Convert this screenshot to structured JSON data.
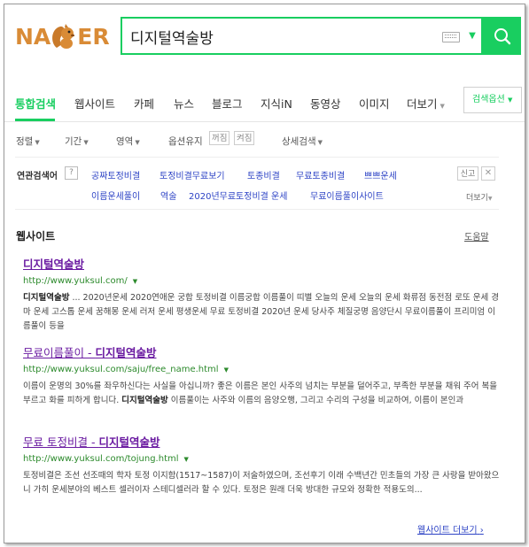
{
  "header": {
    "logo_left": "NA",
    "logo_right": "ER",
    "query": "디지털역술방"
  },
  "tabs": [
    {
      "label": "통합검색"
    },
    {
      "label": "웹사이트"
    },
    {
      "label": "카페"
    },
    {
      "label": "뉴스"
    },
    {
      "label": "블로그"
    },
    {
      "label": "지식iN"
    },
    {
      "label": "동영상"
    },
    {
      "label": "이미지"
    },
    {
      "label": "더보기"
    }
  ],
  "search_options_label": "검색옵션",
  "filters": {
    "sort": "정렬",
    "period": "기간",
    "area": "영역",
    "option_keep": "옵션유지",
    "off": "꺼짐",
    "on": "켜짐",
    "detail": "상세검색"
  },
  "related": {
    "title": "연관검색어",
    "help": "?",
    "links_row1": [
      "공짜토정비결",
      "토정비결무료보기",
      "토종비결",
      "무료토종비결",
      "쁘쁘운세"
    ],
    "links_row2": [
      "이름운세풀이",
      "역술",
      "2020년무료토정비결 운세",
      "무료이름풀이사이트"
    ],
    "report": "신고",
    "more": "더보기"
  },
  "web_section": {
    "title": "웹사이트",
    "help": "도움말",
    "more": "웹사이트 더보기",
    "results": [
      {
        "title_plain": "",
        "title_bold": "디지털역술방",
        "url": "http://www.yuksul.com/",
        "desc_bold": "디지털역술방",
        "desc": " ... 2020년운세 2020연애운 궁합 토정비결 이름궁합 이름풀이 띠별 오늘의 운세 오늘의 운세 화류점 동전점 로또 운세 경마 운세 고스톱 운세 꿈해몽 운세 러저 운세 평생운세 무료 토정비결 2020년 운세 당사주 체질궁명 음양단시 무료이름풀이 프리미엄 이름풀이 등을"
      },
      {
        "title_plain": "무료이름풀이 - ",
        "title_bold": "디지털역술방",
        "url": "http://www.yuksul.com/saju/free_name.html",
        "desc_pre": "이름이 운명의 30%를 좌우하신다는 사실을 아십니까? 좋은 이름은 본인 사주의 넘치는 부분을 덜어주고, 부족한 부분을 채워 주어 복을 부르고 화를 피하게 합니다. ",
        "desc_bold": "디지털역술방",
        "desc_post": " 이름풀이는 사주와 이름의 음양오행, 그리고 수리의 구성을 비교하여, 이름이 본인과"
      },
      {
        "title_plain": "무료 토정비결 - ",
        "title_bold": "디지털역술방",
        "url": "http://www.yuksul.com/tojung.html",
        "desc": "토정비결은 조선 선조때의 학자 토정 이지함(1517~1587)이 저술하였으며, 조선후기 이래 수백년간 민초들의 가장 큰 사랑을 받아왔으니 가히 운세분야의 베스트 셀러이자 스테디셀러라 할 수 있다. 토정은 원래 더욱 방대한 규모와 정확한 적용도의..."
      }
    ]
  },
  "colors": {
    "brand_green": "#19ce60",
    "logo_orange": "#d98b36",
    "link_blue": "#2d43c5",
    "visited_purple": "#6a1aa1",
    "url_green": "#2c8a2c"
  }
}
